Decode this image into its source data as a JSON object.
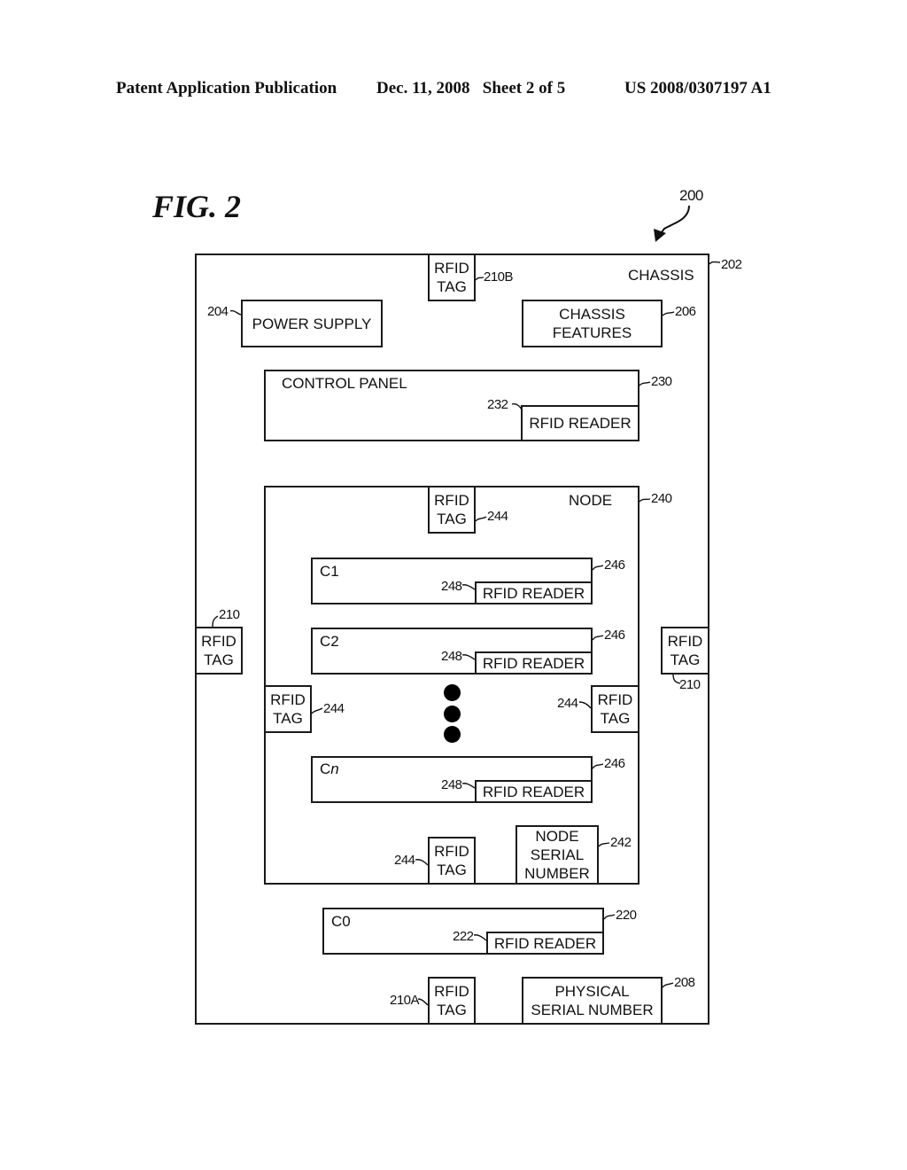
{
  "header": {
    "publication": "Patent Application Publication",
    "date_sheet": "Dec. 11, 2008   Sheet 2 of 5",
    "patent_number": "US 2008/0307197 A1"
  },
  "figure": {
    "title": "FIG. 2",
    "ref": "200"
  },
  "chassis": {
    "label": "CHASSIS",
    "ref": "202",
    "power_supply": {
      "label": "POWER SUPPLY",
      "ref": "204"
    },
    "chassis_features": {
      "label": "CHASSIS\nFEATURES",
      "ref": "206"
    },
    "tag_top": {
      "label": "RFID\nTAG",
      "ref": "210B"
    },
    "tag_left": {
      "label": "RFID\nTAG",
      "ref": "210"
    },
    "tag_right": {
      "label": "RFID\nTAG",
      "ref": "210"
    },
    "tag_bottom": {
      "label": "RFID\nTAG",
      "ref": "210A"
    },
    "physical_serial": {
      "label": "PHYSICAL\nSERIAL NUMBER",
      "ref": "208"
    }
  },
  "control_panel": {
    "label": "CONTROL PANEL",
    "ref": "230",
    "reader": {
      "label": "RFID READER",
      "ref": "232"
    }
  },
  "node": {
    "label": "NODE",
    "ref": "240",
    "tag_top": {
      "label": "RFID\nTAG",
      "ref": "244"
    },
    "tag_left": {
      "label": "RFID\nTAG",
      "ref": "244"
    },
    "tag_right": {
      "label": "RFID\nTAG",
      "ref": "244"
    },
    "tag_bottom": {
      "label": "RFID\nTAG",
      "ref": "244"
    },
    "serial": {
      "label": "NODE\nSERIAL\nNUMBER",
      "ref": "242"
    },
    "components": [
      {
        "name": "C1",
        "ref": "246",
        "reader_label": "RFID READER",
        "reader_ref": "248"
      },
      {
        "name": "C2",
        "ref": "246",
        "reader_label": "RFID READER",
        "reader_ref": "248"
      },
      {
        "name_prefix": "C",
        "name_suffix": "n",
        "ref": "246",
        "reader_label": "RFID READER",
        "reader_ref": "248"
      }
    ]
  },
  "c0": {
    "name": "C0",
    "ref": "220",
    "reader": {
      "label": "RFID READER",
      "ref": "222"
    }
  }
}
